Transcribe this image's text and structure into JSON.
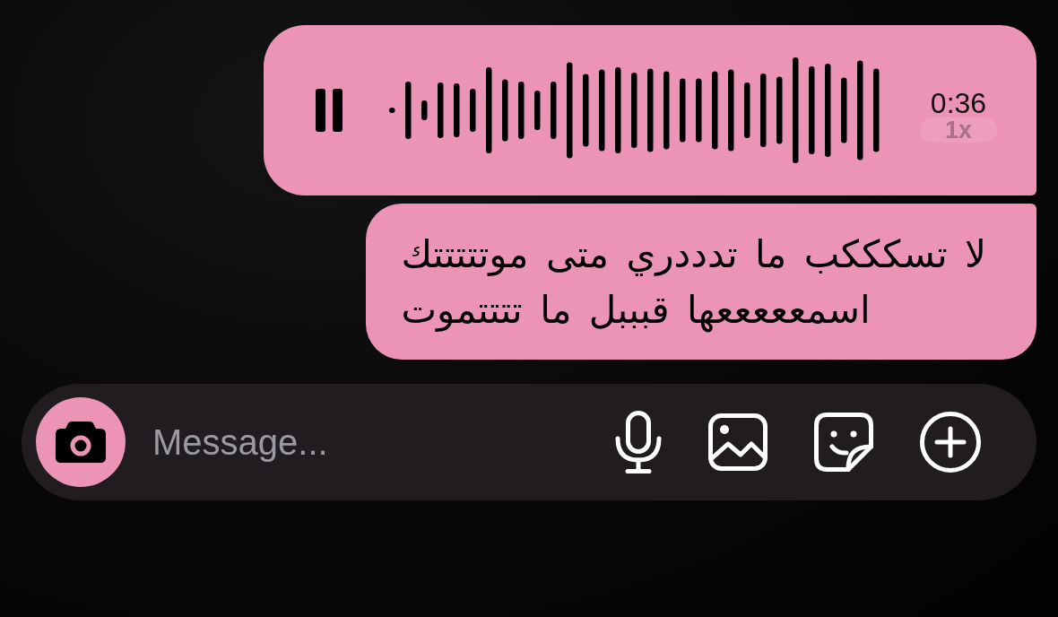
{
  "messages": [
    {
      "kind": "voice",
      "playing": true,
      "duration": "0:36",
      "speed": "1x"
    },
    {
      "kind": "text",
      "text": "لا تسكككب ما تدددري متى موتتتتتك\nاسمعععععها قبببل ما تتتتموت"
    }
  ],
  "composer": {
    "placeholder": "Message..."
  }
}
